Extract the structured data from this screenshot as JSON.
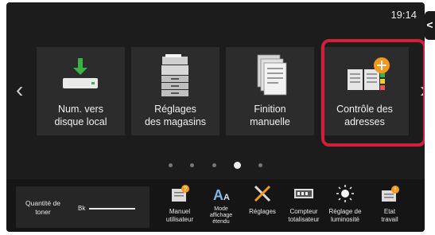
{
  "status": {
    "time": "19:14",
    "side_tab": "<"
  },
  "nav": {
    "prev": "‹",
    "next": "›"
  },
  "tiles": [
    {
      "line1": "Num. vers",
      "line2": "disque local",
      "icon": "download-to-disk-icon"
    },
    {
      "line1": "Réglages",
      "line2": "des magasins",
      "icon": "printer-trays-icon"
    },
    {
      "line1": "Finition",
      "line2": "manuelle",
      "icon": "document-stack-icon"
    },
    {
      "line1": "Contrôle des",
      "line2": "adresses",
      "icon": "address-book-add-icon",
      "highlighted": true
    }
  ],
  "pager": {
    "pages": 5,
    "current": 4
  },
  "toner": {
    "label_line1": "Quantité de",
    "label_line2": "toner",
    "color_label": "Bk"
  },
  "bottom_items": [
    {
      "line1": "Manuel",
      "line2": "utilisateur",
      "line3": "",
      "icon": "user-manual-icon"
    },
    {
      "line1": "Mode",
      "line2": "affichage",
      "line3": "étendu",
      "icon": "font-size-icon"
    },
    {
      "line1": "Réglages",
      "line2": "",
      "line3": "",
      "icon": "settings-tools-icon"
    },
    {
      "line1": "Compteur",
      "line2": "totalisateur",
      "line3": "",
      "icon": "counter-icon"
    },
    {
      "line1": "Réglage de",
      "line2": "luminosité",
      "line3": "",
      "icon": "brightness-icon"
    },
    {
      "line1": "Etat",
      "line2": "travail",
      "line3": "",
      "icon": "job-status-icon"
    }
  ],
  "colors": {
    "highlight": "#d21f3c",
    "accent_green": "#3cb043",
    "accent_orange": "#f39a1e",
    "panel_bg": "#1c1c1c",
    "tile_bg": "#2c2c2c"
  }
}
